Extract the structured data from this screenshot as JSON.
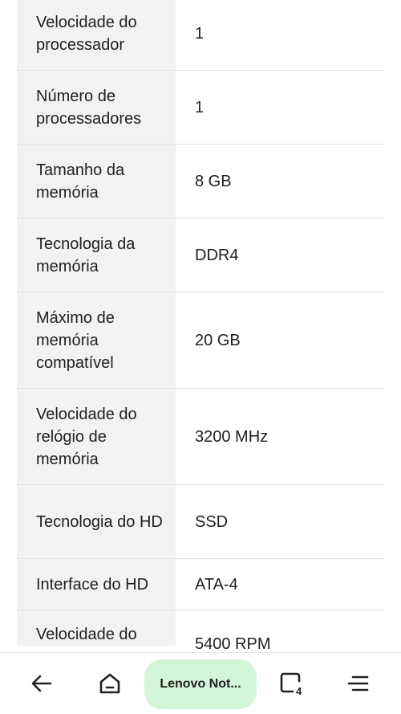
{
  "specs": [
    {
      "label": "Velocidade do processador",
      "value": "1"
    },
    {
      "label": "Número de processadores",
      "value": "1"
    },
    {
      "label": "Tamanho da memória",
      "value": "8 GB"
    },
    {
      "label": "Tecnologia da memória",
      "value": "DDR4"
    },
    {
      "label": "Máximo de memória compatível",
      "value": "20 GB"
    },
    {
      "label": "Velocidade do relógio de memória",
      "value": "3200 MHz"
    },
    {
      "label": "Tecnologia do HD",
      "value": "SSD"
    },
    {
      "label": "Interface do HD",
      "value": "ATA-4"
    },
    {
      "label": "Velocidade do",
      "value": "5400 RPM"
    }
  ],
  "nav": {
    "tab_title": "Lenovo Not...",
    "tab_count": "4",
    "icons": [
      "back-arrow-icon",
      "home-icon",
      "tabs-icon",
      "menu-icon"
    ]
  }
}
